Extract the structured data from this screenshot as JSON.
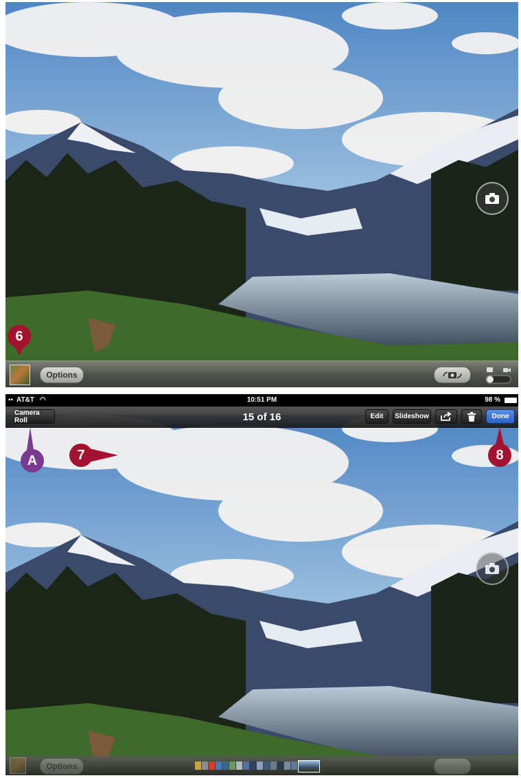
{
  "camera_screen": {
    "options_label": "Options"
  },
  "photo_screen": {
    "status": {
      "carrier": "AT&T",
      "time": "10:51 PM",
      "battery": "98 %"
    },
    "nav": {
      "back_label": "Camera Roll",
      "title": "15 of 16",
      "edit_label": "Edit",
      "slideshow_label": "Slideshow",
      "done_label": "Done"
    },
    "options_label": "Options"
  },
  "callouts": {
    "six": "6",
    "a": "A",
    "seven": "7",
    "eight": "8"
  },
  "colors": {
    "callout_red": "#a3122f",
    "callout_purple": "#7a3a8e",
    "done_blue": "#2a60cc"
  }
}
